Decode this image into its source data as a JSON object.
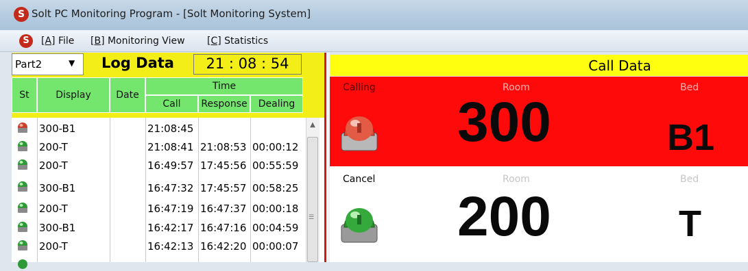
{
  "window": {
    "title": "Solt PC Monitoring Program - [Solt Monitoring System]",
    "logo_letter": "S"
  },
  "menu": {
    "items": [
      {
        "key": "[A]",
        "label": " File"
      },
      {
        "key": "[B]",
        "label": " Monitoring View"
      },
      {
        "key": "[C]",
        "label": " Statistics"
      }
    ]
  },
  "log_panel": {
    "part_select": "Part2",
    "title": "Log Data",
    "clock": "21 : 08 : 54",
    "headers": {
      "st": "St",
      "display": "Display",
      "date": "Date",
      "time": "Time",
      "call": "Call",
      "response": "Response",
      "dealing": "Dealing"
    },
    "rows": [
      {
        "status": "red",
        "display": "300-B1",
        "date": "",
        "call": "21:08:45",
        "response": "",
        "dealing": ""
      },
      {
        "status": "green",
        "display": "200-T",
        "date": "",
        "call": "21:08:41",
        "response": "21:08:53",
        "dealing": "00:00:12"
      },
      {
        "status": "green",
        "display": "200-T",
        "date": "",
        "call": "16:49:57",
        "response": "17:45:56",
        "dealing": "00:55:59"
      },
      {
        "status": "green",
        "display": "300-B1",
        "date": "",
        "call": "16:47:32",
        "response": "17:45:57",
        "dealing": "00:58:25"
      },
      {
        "status": "green",
        "display": "200-T",
        "date": "",
        "call": "16:47:19",
        "response": "16:47:37",
        "dealing": "00:00:18"
      },
      {
        "status": "green",
        "display": "300-B1",
        "date": "",
        "call": "16:42:17",
        "response": "16:47:16",
        "dealing": "00:04:59"
      },
      {
        "status": "green",
        "display": "200-T",
        "date": "",
        "call": "16:42:13",
        "response": "16:42:20",
        "dealing": "00:00:07"
      }
    ]
  },
  "call_panel": {
    "title": "Call Data",
    "entries": [
      {
        "status": "Calling",
        "room_label": "Room",
        "room": "300",
        "bed_label": "Bed",
        "bed": "B1",
        "color": "#ff0a0a",
        "lamp": "red"
      },
      {
        "status": "Cancel",
        "room_label": "Room",
        "room": "200",
        "bed_label": "Bed",
        "bed": "T",
        "color": "#ffffff",
        "lamp": "green"
      }
    ]
  },
  "colors": {
    "accent_yellow": "#f4ee18",
    "header_green": "#74e56d",
    "alert_red": "#ff0a0a",
    "divider_red": "#d21717"
  }
}
